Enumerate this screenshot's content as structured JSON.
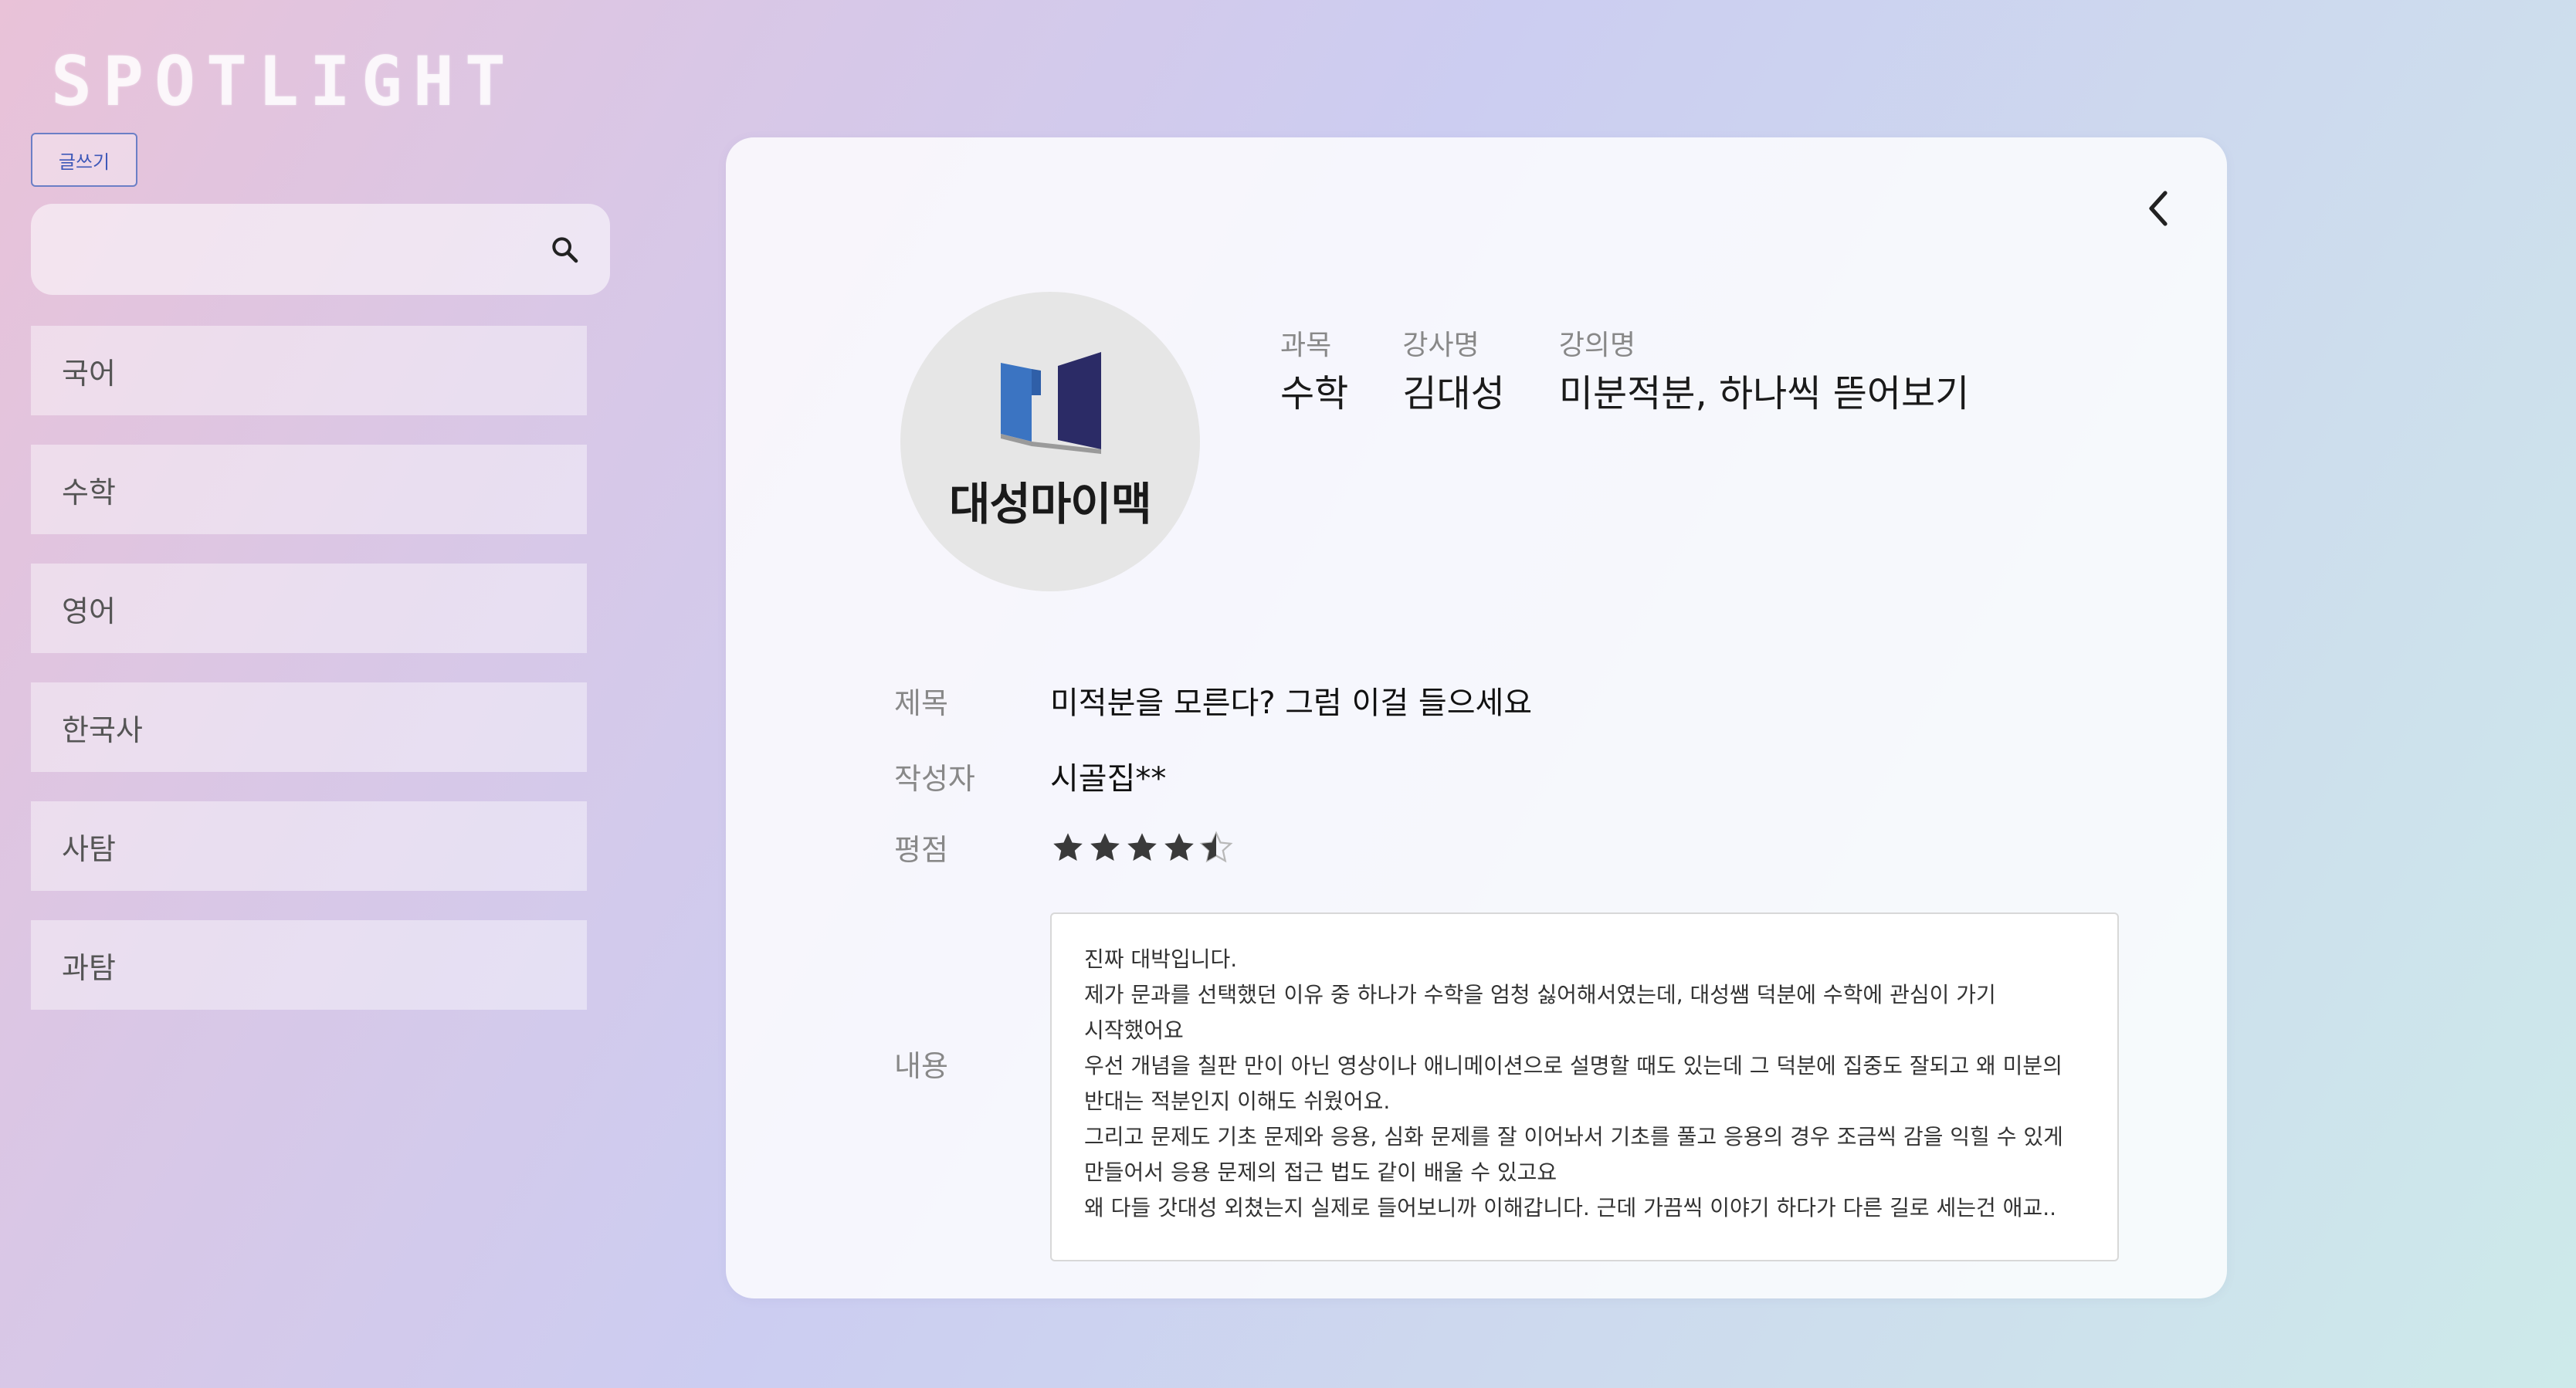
{
  "brand": {
    "title": "SPOTLIGHT"
  },
  "toolbar": {
    "write_label": "글쓰기"
  },
  "search": {
    "value": "",
    "placeholder": ""
  },
  "categories": [
    {
      "label": "국어"
    },
    {
      "label": "수학"
    },
    {
      "label": "영어"
    },
    {
      "label": "한국사"
    },
    {
      "label": "사탐"
    },
    {
      "label": "과탐"
    }
  ],
  "detail": {
    "logo": {
      "text": "대성마이맥"
    },
    "meta": {
      "subject": {
        "label": "과목",
        "value": "수학"
      },
      "instructor": {
        "label": "강사명",
        "value": "김대성"
      },
      "lecture": {
        "label": "강의명",
        "value": "미분적분, 하나씩 뜯어보기"
      }
    },
    "fields": {
      "title": {
        "label": "제목",
        "value": "미적분을 모른다? 그럼 이걸 들으세요"
      },
      "author": {
        "label": "작성자",
        "value": "시골집**"
      },
      "rating": {
        "label": "평점",
        "value": 4.5,
        "max": 5
      },
      "content_label": "내용"
    },
    "content": [
      "진짜 대박입니다.",
      "제가 문과를 선택했던 이유 중 하나가 수학을 엄청 싫어해서였는데, 대성쌤 덕분에 수학에 관심이 가기",
      "시작했어요",
      "우선 개념을 칠판 만이 아닌 영상이나 애니메이션으로 설명할 때도 있는데 그 덕분에 집중도 잘되고 왜 미분의",
      "반대는 적분인지 이해도 쉬웠어요.",
      "그리고 문제도 기초 문제와 응용, 심화 문제를 잘 이어놔서 기초를 풀고 응용의 경우 조금씩 감을 익힐 수 있게",
      "만들어서 응용 문제의 접근 법도 같이 배울 수 있고요",
      "왜 다들 갓대성 외쳤는지 실제로 들어보니까 이해갑니다. 근데 가끔씩 이야기 하다가 다른 길로 세는건 애교.."
    ]
  },
  "colors": {
    "accent": "#3e58b8",
    "star": "#3a3a3a",
    "logo_blue": "#3b74c2",
    "logo_navy": "#2b2b66"
  },
  "icons": {
    "search": "search-icon",
    "back": "chevron-left-icon",
    "star": "star-icon"
  }
}
